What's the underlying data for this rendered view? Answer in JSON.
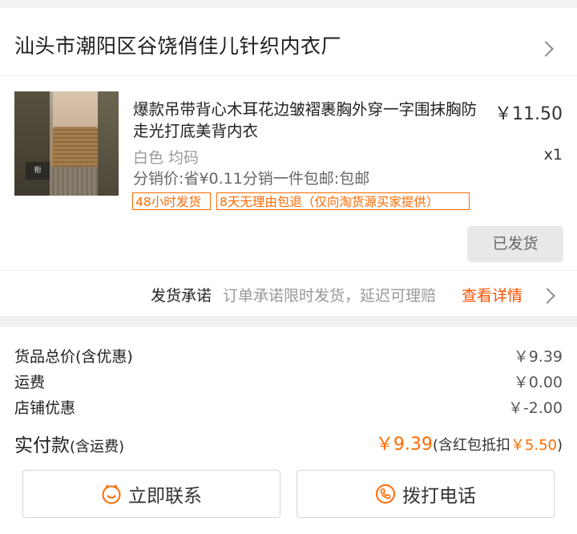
{
  "shop": {
    "name": "汕头市潮阳区谷饶俏佳儿针织内衣厂"
  },
  "item": {
    "title": "爆款吊带背心木耳花边皱褶裹胸外穿一字围抹胸防走光打底美背内衣",
    "price": "￥11.50",
    "quantity": "x1",
    "sku": "白色 均码",
    "promo": "分销价:省¥0.11分销一件包邮:包邮",
    "tags": [
      "48小时发货",
      "8天无理由包退（仅向淘货源买家提供）"
    ],
    "status_button": "已发货",
    "thumb_text": "衔"
  },
  "promise": {
    "label": "发货承诺",
    "desc": "订单承诺限时发货，延迟可理赔",
    "link": "查看详情"
  },
  "summary": {
    "goods_total_label": "货品总价(含优惠)",
    "goods_total_value": "￥9.39",
    "shipping_label": "运费",
    "shipping_value": "￥0.00",
    "discount_label": "店铺优惠",
    "discount_value": "￥-2.00",
    "paid_label": "实付款",
    "paid_label_suffix": "(含运费)",
    "paid_amount": "￥9.39",
    "paid_note_prefix": "(含红包抵扣",
    "paid_note_amount": "￥5.50",
    "paid_note_suffix": ")"
  },
  "actions": {
    "contact": "立即联系",
    "call": "拨打电话"
  },
  "colors": {
    "accent": "#ff6a00",
    "link": "#ff5000"
  }
}
